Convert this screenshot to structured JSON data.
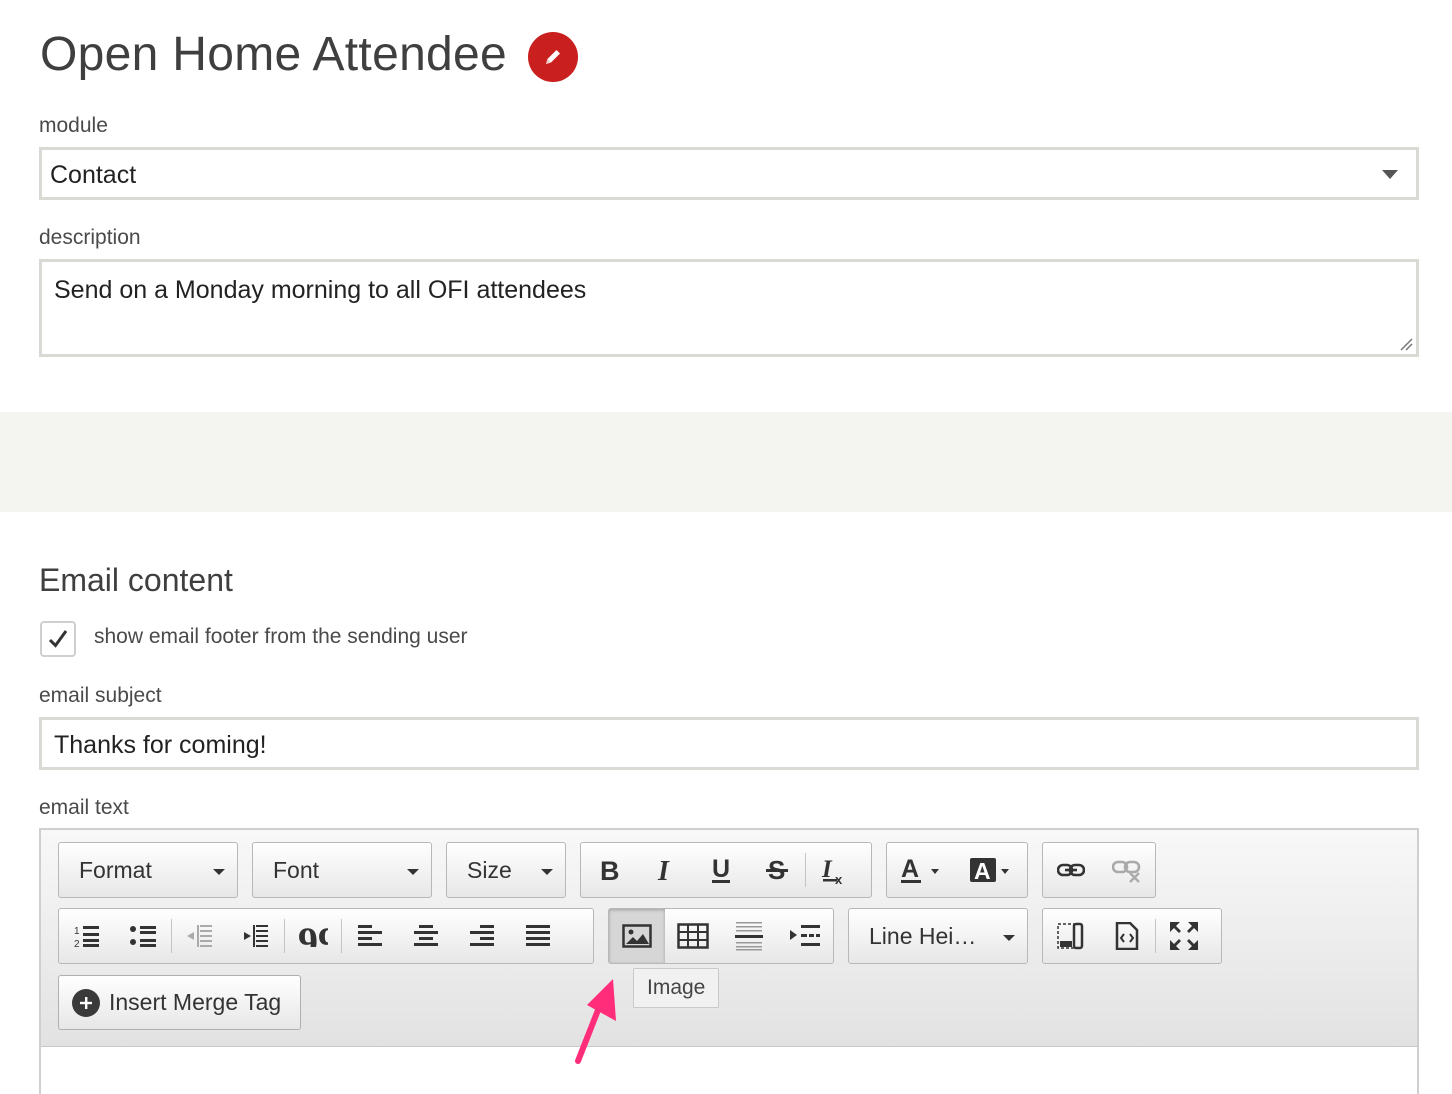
{
  "header": {
    "title": "Open Home Attendee"
  },
  "form": {
    "module_label": "module",
    "module_value": "Contact",
    "description_label": "description",
    "description_value": "Send on a Monday morning to all OFI attendees"
  },
  "email": {
    "section_title": "Email content",
    "footer_checkbox_label": "show email footer from the sending user",
    "footer_checked": true,
    "subject_label": "email subject",
    "subject_value": "Thanks for coming!",
    "text_label": "email text"
  },
  "toolbar": {
    "format": "Format",
    "font": "Font",
    "size": "Size",
    "line_height": "Line Hei…",
    "merge_tag": "Insert Merge Tag",
    "tooltip": "Image"
  },
  "colors": {
    "accent": "#c9201f",
    "pointer": "#ff2d7a"
  }
}
